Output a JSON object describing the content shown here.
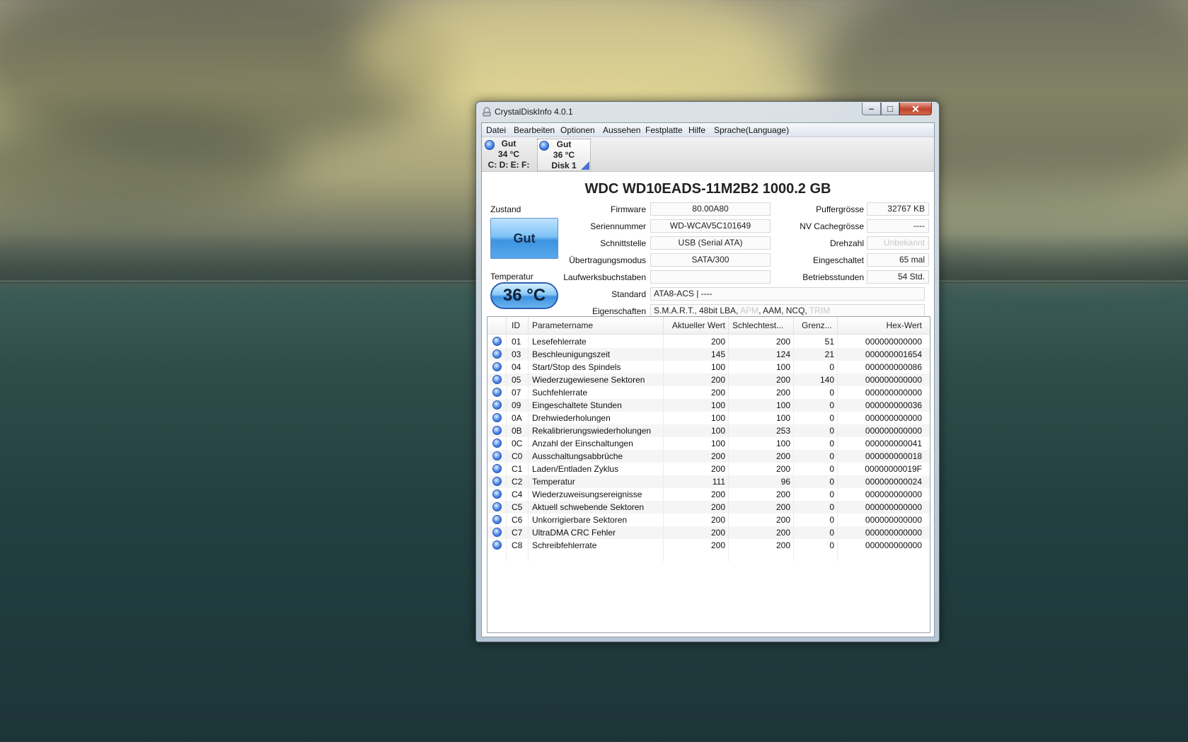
{
  "window": {
    "title": "CrystalDiskInfo 4.0.1",
    "min_glyph": "–",
    "max_glyph": "□",
    "close_glyph": "✕"
  },
  "menu": [
    "Datei",
    "Bearbeiten",
    "Optionen",
    "Aussehen",
    "Festplatte",
    "Hilfe",
    "Sprache(Language)"
  ],
  "disks": [
    {
      "status": "Gut",
      "temp": "34 °C",
      "label": "C: D: E: F:"
    },
    {
      "status": "Gut",
      "temp": "36 °C",
      "label": "Disk 1"
    }
  ],
  "drive": {
    "model": "WDC WD10EADS-11M2B2  1000.2 GB",
    "zustand_label": "Zustand",
    "health": "Gut",
    "temperatur_label": "Temperatur",
    "temperature": "36 °C",
    "firmware_label": "Firmware",
    "firmware": "80.00A80",
    "serial_label": "Seriennummer",
    "serial": "WD-WCAV5C101649",
    "interface_label": "Schnittstelle",
    "interface": "USB (Serial ATA)",
    "transfer_label": "Übertragungsmodus",
    "transfer": "SATA/300",
    "letters_label": "Laufwerksbuchstaben",
    "letters": "",
    "standard_label": "Standard",
    "standard": "ATA8-ACS | ----",
    "features_label": "Eigenschaften",
    "features": {
      "smart": "S.M.A.R.T., 48bit LBA, ",
      "apm": "APM",
      "mid": ", AAM, NCQ, ",
      "trim": "TRIM"
    },
    "buffer_label": "Puffergrösse",
    "buffer": "32767 KB",
    "nvcache_label": "NV Cachegrösse",
    "nvcache": "----",
    "rpm_label": "Drehzahl",
    "rpm": "Unbekannt",
    "powercount_label": "Eingeschaltet",
    "powercount": "65 mal",
    "hours_label": "Betriebsstunden",
    "hours": "54 Std."
  },
  "smart": {
    "headers": {
      "id": "ID",
      "name": "Parametername",
      "current": "Aktueller Wert",
      "worst": "Schlechtest...",
      "threshold": "Grenz...",
      "raw": "Hex-Wert"
    },
    "rows": [
      {
        "id": "01",
        "name": "Lesefehlerrate",
        "current": "200",
        "worst": "200",
        "threshold": "51",
        "raw": "000000000000"
      },
      {
        "id": "03",
        "name": "Beschleunigungszeit",
        "current": "145",
        "worst": "124",
        "threshold": "21",
        "raw": "000000001654"
      },
      {
        "id": "04",
        "name": "Start/Stop des Spindels",
        "current": "100",
        "worst": "100",
        "threshold": "0",
        "raw": "000000000086"
      },
      {
        "id": "05",
        "name": "Wiederzugewiesene Sektoren",
        "current": "200",
        "worst": "200",
        "threshold": "140",
        "raw": "000000000000"
      },
      {
        "id": "07",
        "name": "Suchfehlerrate",
        "current": "200",
        "worst": "200",
        "threshold": "0",
        "raw": "000000000000"
      },
      {
        "id": "09",
        "name": "Eingeschaltete Stunden",
        "current": "100",
        "worst": "100",
        "threshold": "0",
        "raw": "000000000036"
      },
      {
        "id": "0A",
        "name": "Drehwiederholungen",
        "current": "100",
        "worst": "100",
        "threshold": "0",
        "raw": "000000000000"
      },
      {
        "id": "0B",
        "name": "Rekalibrierungswiederholungen",
        "current": "100",
        "worst": "253",
        "threshold": "0",
        "raw": "000000000000"
      },
      {
        "id": "0C",
        "name": "Anzahl der Einschaltungen",
        "current": "100",
        "worst": "100",
        "threshold": "0",
        "raw": "000000000041"
      },
      {
        "id": "C0",
        "name": "Ausschaltungsabbrüche",
        "current": "200",
        "worst": "200",
        "threshold": "0",
        "raw": "000000000018"
      },
      {
        "id": "C1",
        "name": "Laden/Entladen Zyklus",
        "current": "200",
        "worst": "200",
        "threshold": "0",
        "raw": "00000000019F"
      },
      {
        "id": "C2",
        "name": "Temperatur",
        "current": "111",
        "worst": "96",
        "threshold": "0",
        "raw": "000000000024"
      },
      {
        "id": "C4",
        "name": "Wiederzuweisungsereignisse",
        "current": "200",
        "worst": "200",
        "threshold": "0",
        "raw": "000000000000"
      },
      {
        "id": "C5",
        "name": "Aktuell schwebende Sektoren",
        "current": "200",
        "worst": "200",
        "threshold": "0",
        "raw": "000000000000"
      },
      {
        "id": "C6",
        "name": "Unkorrigierbare Sektoren",
        "current": "200",
        "worst": "200",
        "threshold": "0",
        "raw": "000000000000"
      },
      {
        "id": "C7",
        "name": "UltraDMA CRC Fehler",
        "current": "200",
        "worst": "200",
        "threshold": "0",
        "raw": "000000000000"
      },
      {
        "id": "C8",
        "name": "Schreibfehlerrate",
        "current": "200",
        "worst": "200",
        "threshold": "0",
        "raw": "000000000000"
      }
    ]
  },
  "colors": {
    "health_good": "#3d93e0",
    "accent": "#2a5fb5"
  }
}
